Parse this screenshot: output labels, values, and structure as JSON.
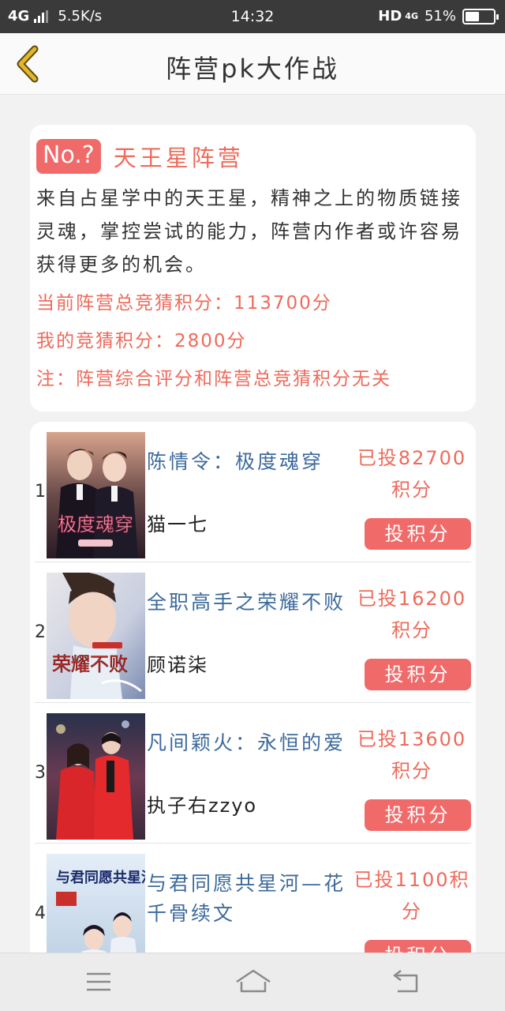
{
  "status_bar": {
    "network": "4G",
    "speed": "5.5K/s",
    "time": "14:32",
    "hd": "HD",
    "net2": "4G",
    "battery": "51%",
    "battery_level": 0.51
  },
  "nav": {
    "title": "阵营pk大作战"
  },
  "camp": {
    "badge": "No.?",
    "name": "天王星阵营",
    "description": "来自占星学中的天王星，精神之上的物质链接灵魂，掌控尝试的能力，阵营内作者或许容易获得更多的机会。",
    "total_points": "当前阵营总竞猜积分：113700分",
    "my_points": "我的竞猜积分：2800分",
    "note": "注：阵营综合评分和阵营总竞猜积分无关"
  },
  "books": [
    {
      "rank": "1",
      "title": "陈情令：极度魂穿",
      "author": "猫一七",
      "voted": "已投82700积分",
      "button": "投积分",
      "cover_text": "极度魂穿"
    },
    {
      "rank": "2",
      "title": "全职高手之荣耀不败",
      "author": "顾诺柒",
      "voted": "已投16200积分",
      "button": "投积分",
      "cover_text": "荣耀不败"
    },
    {
      "rank": "3",
      "title": "凡间颖火：永恒的爱",
      "author": "执子右zzyo",
      "voted": "已投13600积分",
      "button": "投积分",
      "cover_text": ""
    },
    {
      "rank": "4",
      "title": "与君同愿共星河—花千骨续文",
      "author": "",
      "voted": "已投1100积分",
      "button": "投积分",
      "cover_text": "与君同愿共星河"
    }
  ],
  "colors": {
    "accent": "#f06a6a",
    "title_blue": "#3d6a9c",
    "statusbar": "#3a3a3a",
    "back_arrow": "#e2b72a"
  },
  "icons": {
    "back": "chevron-left-icon",
    "menu": "menu-icon",
    "home": "home-icon",
    "return": "return-icon"
  }
}
